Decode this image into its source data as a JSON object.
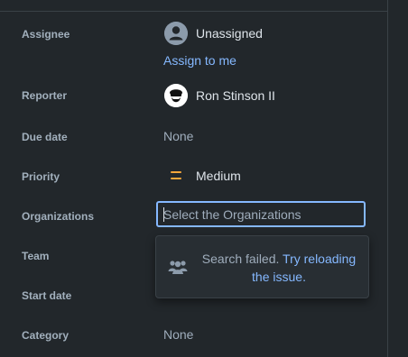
{
  "fields": {
    "assignee": {
      "label": "Assignee",
      "value": "Unassigned",
      "action": "Assign to me"
    },
    "reporter": {
      "label": "Reporter",
      "value": "Ron Stinson II"
    },
    "due_date": {
      "label": "Due date",
      "value": "None"
    },
    "priority": {
      "label": "Priority",
      "value": "Medium",
      "icon": "medium-priority-icon",
      "color": "#f8a73b"
    },
    "organizations": {
      "label": "Organizations",
      "placeholder": "Select the Organizations"
    },
    "team": {
      "label": "Team"
    },
    "start_date": {
      "label": "Start date"
    },
    "category": {
      "label": "Category",
      "value": "None"
    }
  },
  "dropdown": {
    "message": "Search failed.",
    "link": "Try reloading the issue.",
    "icon": "people-group-icon"
  },
  "colors": {
    "background": "#22272b",
    "link": "#85b8ff",
    "focus_border": "#85b8ff"
  }
}
